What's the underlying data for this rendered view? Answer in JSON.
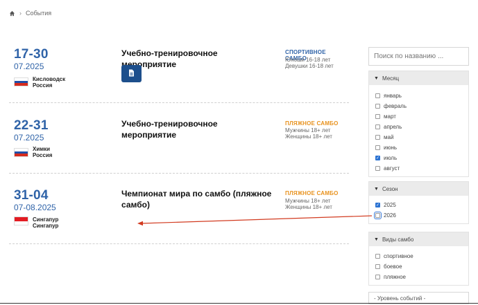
{
  "breadcrumb": {
    "current": "События"
  },
  "events": [
    {
      "date_big": "17-30",
      "date_small": "07.2025",
      "city": "Кисловодск",
      "country": "Россия",
      "flag": "ru",
      "title": "Учебно-тренировочное мероприятие",
      "sport": "СПОРТИВНОЕ САМБО",
      "sport_color": "#2f63a8",
      "ages": [
        "Юноши 16-18 лет",
        "Девушки 16-18 лет"
      ],
      "has_document": true
    },
    {
      "date_big": "22-31",
      "date_small": "07.2025",
      "city": "Химки",
      "country": "Россия",
      "flag": "ru",
      "title": "Учебно-тренировочное мероприятие",
      "sport": "ПЛЯЖНОЕ САМБО",
      "sport_color": "#e8921e",
      "ages": [
        "Мужчины 18+ лет",
        "Женщины 18+ лет"
      ],
      "has_document": false
    },
    {
      "date_big": "31-04",
      "date_small": "07-08.2025",
      "city": "Сингапур",
      "country": "Сингапур",
      "flag": "sg",
      "title_line1": "Чемпионат мира по самбо (пляжное",
      "title_line2": "самбо)",
      "sport": "ПЛЯЖНОЕ САМБО",
      "sport_color": "#e8921e",
      "ages": [
        "Мужчины 18+ лет",
        "Женщины 18+ лет"
      ],
      "has_document": false
    }
  ],
  "sidebar": {
    "search_placeholder": "Поиск по названию ...",
    "month": {
      "label": "Месяц",
      "options": [
        {
          "label": "январь",
          "checked": false
        },
        {
          "label": "февраль",
          "checked": false
        },
        {
          "label": "март",
          "checked": false
        },
        {
          "label": "апрель",
          "checked": false
        },
        {
          "label": "май",
          "checked": false
        },
        {
          "label": "июнь",
          "checked": false
        },
        {
          "label": "июль",
          "checked": true
        },
        {
          "label": "август",
          "checked": false
        }
      ]
    },
    "season": {
      "label": "Сезон",
      "options": [
        {
          "label": "2025",
          "checked": true
        },
        {
          "label": "2026",
          "checked": false
        }
      ]
    },
    "sambo_types": {
      "label": "Виды самбо",
      "options": [
        {
          "label": "спортивное",
          "checked": false
        },
        {
          "label": "боевое",
          "checked": false
        },
        {
          "label": "пляжное",
          "checked": false
        }
      ]
    },
    "level_select": "- Уровень событий -"
  },
  "icons": {
    "home": "home-icon",
    "breadcrumb_separator": "chevron-right-icon",
    "document": "document-icon",
    "caret": "caret-down-icon"
  },
  "colors": {
    "accent_blue": "#2f63a8",
    "beach_orange": "#e8921e",
    "button_blue": "#1d4f8c",
    "annotation_arrow": "#d23a1f"
  }
}
